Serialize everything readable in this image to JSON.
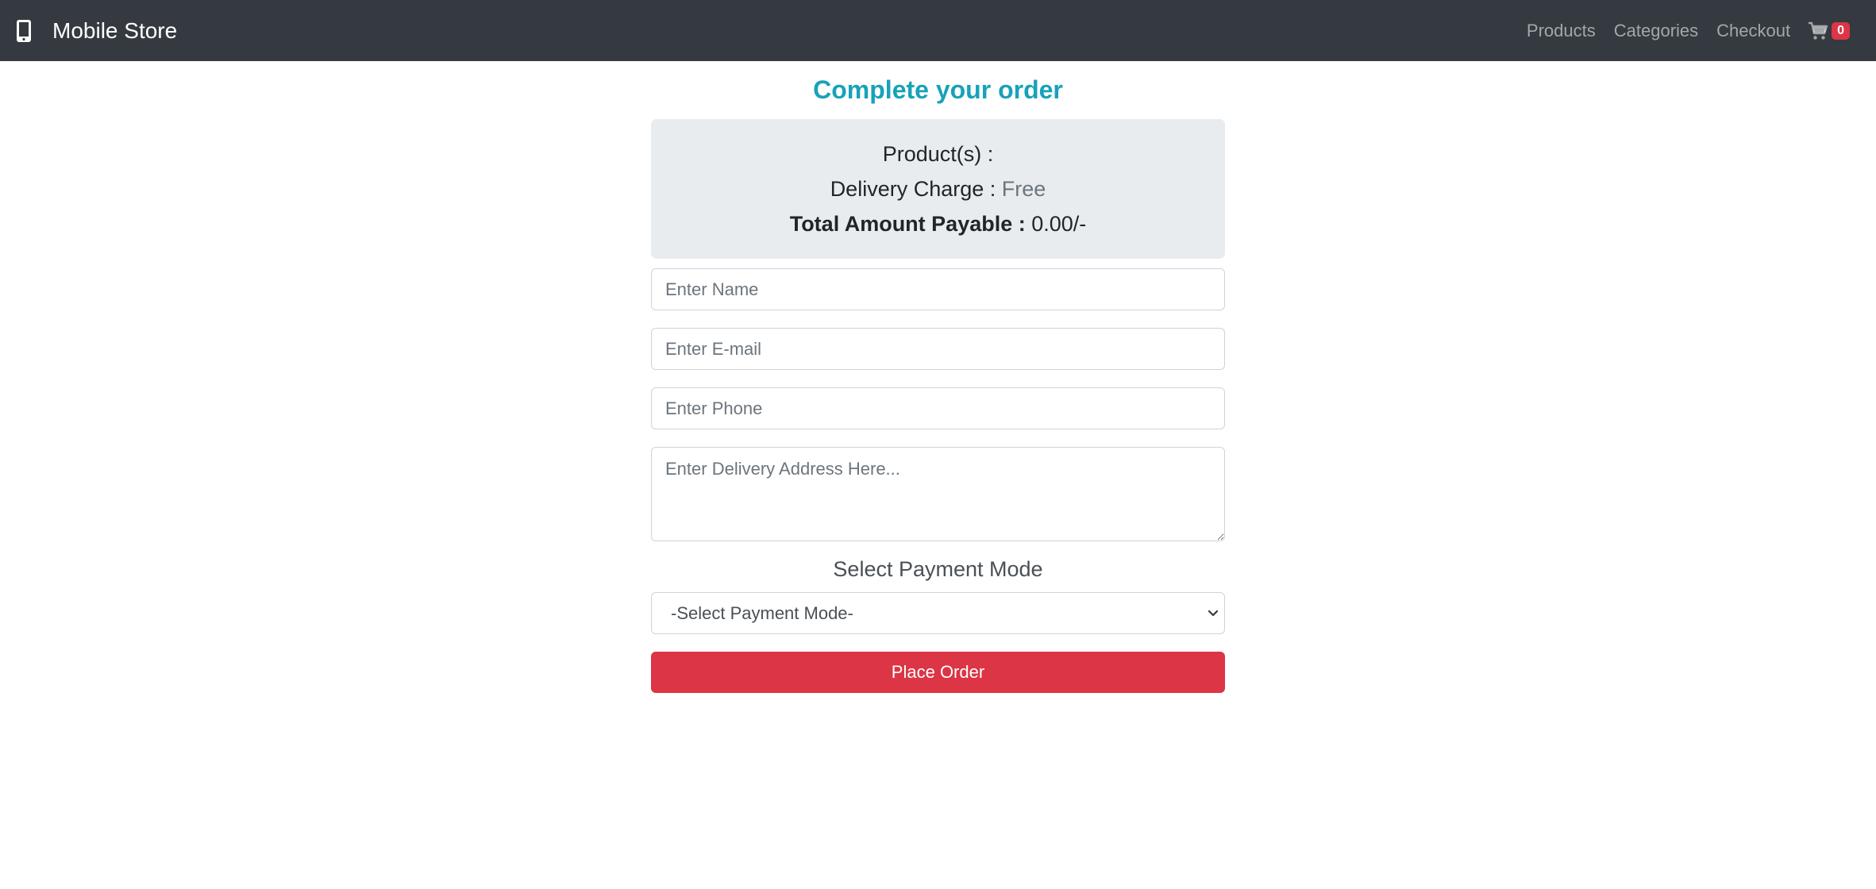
{
  "navbar": {
    "brand": "Mobile Store",
    "brand_icon": "mobile-phone-icon",
    "links": [
      "Products",
      "Categories",
      "Checkout"
    ],
    "cart_icon": "shopping-cart-icon",
    "cart_count": "0"
  },
  "page": {
    "title": "Complete your order"
  },
  "summary": {
    "products_label": "Product(s) :",
    "delivery_label": "Delivery Charge :",
    "delivery_value": "Free",
    "total_label": "Total Amount Payable :",
    "total_value": "0.00/-"
  },
  "form": {
    "name_placeholder": "Enter Name",
    "email_placeholder": "Enter E-mail",
    "phone_placeholder": "Enter Phone",
    "address_placeholder": "Enter Delivery Address Here...",
    "payment_label": "Select Payment Mode",
    "payment_selected": "-Select Payment Mode-",
    "submit_label": "Place Order"
  },
  "colors": {
    "navbar_bg": "#343a40",
    "title": "#17a2b8",
    "summary_bg": "#e9ecef",
    "button": "#dc3545",
    "badge": "#dc3545"
  }
}
